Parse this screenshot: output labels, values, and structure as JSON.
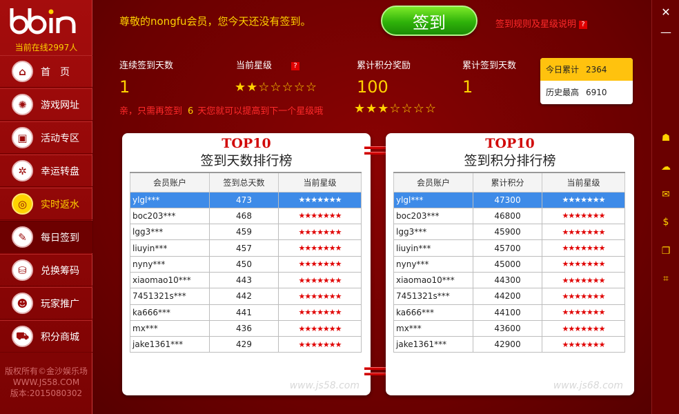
{
  "sidebar": {
    "logo_text": "bbin",
    "online": "当前在线2997人",
    "items": [
      {
        "label": "首　页",
        "icon": "home-icon",
        "glyph": "⌂"
      },
      {
        "label": "游戏网址",
        "icon": "sun-icon",
        "glyph": "✺"
      },
      {
        "label": "活动专区",
        "icon": "gift-icon",
        "glyph": "▣"
      },
      {
        "label": "幸运转盘",
        "icon": "wheel-icon",
        "glyph": "✲"
      },
      {
        "label": "实时返水",
        "icon": "coins-icon",
        "glyph": "◎"
      },
      {
        "label": "每日签到",
        "icon": "edit-icon",
        "glyph": "✎"
      },
      {
        "label": "兑换筹码",
        "icon": "chips-icon",
        "glyph": "⛁"
      },
      {
        "label": "玩家推广",
        "icon": "users-icon",
        "glyph": "☻"
      },
      {
        "label": "积分商城",
        "icon": "cart-icon",
        "glyph": "⛟"
      }
    ],
    "footer": [
      "版权所有©金沙娱乐场",
      "WWW.JS58.COM",
      "版本:2015080302"
    ]
  },
  "header": {
    "greeting": "尊敬的nongfu会员，您今天还没有签到。",
    "signin_button": "签到",
    "rules_link": "签到规则及星级说明",
    "help_badge": "?"
  },
  "stats": {
    "consecutive_label": "连续签到天数",
    "consecutive_value": "1",
    "level_label": "当前星级",
    "level_stars": 2,
    "level_max": 7,
    "points_label": "累计积分奖励",
    "points_value": "100",
    "total_label": "累计签到天数",
    "total_value": "1",
    "need_text": "亲，只需再签到",
    "need_days": "6",
    "need_suffix": "天您就可以提高到下一个星级哦",
    "next_stars": 3
  },
  "score_box": {
    "today_label": "今日累计",
    "today_value": "2364",
    "best_label": "历史最高",
    "best_value": "6910"
  },
  "left_panel": {
    "top10": "TOP10",
    "title": "签到天数排行榜",
    "headers": [
      "会员账户",
      "签到总天数",
      "当前星级"
    ],
    "rows": [
      [
        "ylgl***",
        "473",
        "★★★★★★★"
      ],
      [
        "boc203***",
        "468",
        "★★★★★★★"
      ],
      [
        "lgg3***",
        "459",
        "★★★★★★★"
      ],
      [
        "liuyin***",
        "457",
        "★★★★★★★"
      ],
      [
        "nyny***",
        "450",
        "★★★★★★★"
      ],
      [
        "xiaomao10***",
        "443",
        "★★★★★★★"
      ],
      [
        "7451321s***",
        "442",
        "★★★★★★★"
      ],
      [
        "ka666***",
        "441",
        "★★★★★★★"
      ],
      [
        "mx***",
        "436",
        "★★★★★★★"
      ],
      [
        "jake1361***",
        "429",
        "★★★★★★★"
      ]
    ],
    "watermark": "www.js58.com"
  },
  "right_panel": {
    "top10": "TOP10",
    "title": "签到积分排行榜",
    "headers": [
      "会员账户",
      "累计积分",
      "当前星级"
    ],
    "rows": [
      [
        "ylgl***",
        "47300",
        "★★★★★★★"
      ],
      [
        "boc203***",
        "46800",
        "★★★★★★★"
      ],
      [
        "lgg3***",
        "45900",
        "★★★★★★★"
      ],
      [
        "liuyin***",
        "45700",
        "★★★★★★★"
      ],
      [
        "nyny***",
        "45000",
        "★★★★★★★"
      ],
      [
        "xiaomao10***",
        "44300",
        "★★★★★★★"
      ],
      [
        "7451321s***",
        "44200",
        "★★★★★★★"
      ],
      [
        "ka666***",
        "44100",
        "★★★★★★★"
      ],
      [
        "mx***",
        "43600",
        "★★★★★★★"
      ],
      [
        "jake1361***",
        "42900",
        "★★★★★★★"
      ]
    ],
    "watermark": "www.js68.com"
  },
  "rail": {
    "close": "✕",
    "minimize": "—",
    "icons": [
      {
        "name": "user-icon",
        "glyph": "☗"
      },
      {
        "name": "chat-icon",
        "glyph": "☁"
      },
      {
        "name": "mail-icon",
        "glyph": "✉"
      },
      {
        "name": "money-icon",
        "glyph": "$"
      },
      {
        "name": "docs-icon",
        "glyph": "❐"
      },
      {
        "name": "qr-icon",
        "glyph": "⌗"
      }
    ]
  },
  "colors": {
    "accent_gold": "#ffd200",
    "brand_red": "#8c0606",
    "selected_row": "#3e8be8",
    "signin_green": "#2fb20a"
  }
}
